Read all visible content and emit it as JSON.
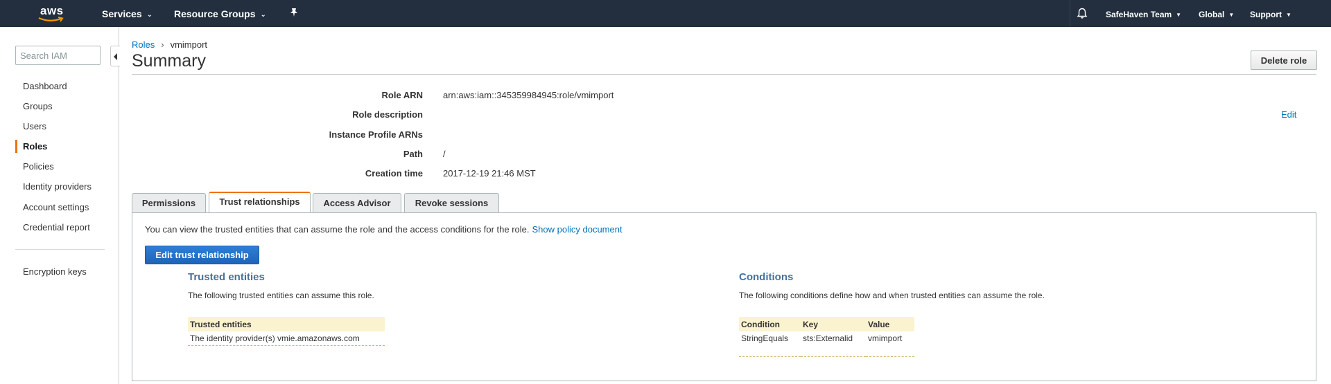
{
  "topnav": {
    "logo_text": "aws",
    "services": "Services",
    "resource_groups": "Resource Groups",
    "account": "SafeHaven Team",
    "region": "Global",
    "support": "Support"
  },
  "sidebar": {
    "search_placeholder": "Search IAM",
    "items": [
      {
        "label": "Dashboard"
      },
      {
        "label": "Groups"
      },
      {
        "label": "Users"
      },
      {
        "label": "Roles",
        "active": true
      },
      {
        "label": "Policies"
      },
      {
        "label": "Identity providers"
      },
      {
        "label": "Account settings"
      },
      {
        "label": "Credential report"
      }
    ],
    "secondary_items": [
      {
        "label": "Encryption keys"
      }
    ]
  },
  "breadcrumb": {
    "parent": "Roles",
    "separator": "›",
    "current": "vmimport"
  },
  "page": {
    "title": "Summary",
    "delete_button": "Delete role",
    "edit_link": "Edit"
  },
  "summary": {
    "role_arn_label": "Role ARN",
    "role_arn_value": "arn:aws:iam::345359984945:role/vmimport",
    "role_description_label": "Role description",
    "instance_profile_label": "Instance Profile ARNs",
    "path_label": "Path",
    "path_value": "/",
    "creation_time_label": "Creation time",
    "creation_time_value": "2017-12-19 21:46 MST"
  },
  "tabs": [
    {
      "label": "Permissions",
      "active": false
    },
    {
      "label": "Trust relationships",
      "active": true
    },
    {
      "label": "Access Advisor",
      "active": false
    },
    {
      "label": "Revoke sessions",
      "active": false
    }
  ],
  "trust": {
    "intro": "You can view the trusted entities that can assume the role and the access conditions for the role.",
    "show_policy_link": "Show policy document",
    "edit_button": "Edit trust relationship",
    "trusted_entities": {
      "title": "Trusted entities",
      "description": "The following trusted entities can assume this role.",
      "header": "Trusted entities",
      "rows": [
        "The identity provider(s) vmie.amazonaws.com"
      ]
    },
    "conditions": {
      "title": "Conditions",
      "description": "The following conditions define how and when trusted entities can assume the role.",
      "headers": [
        "Condition",
        "Key",
        "Value"
      ],
      "rows": [
        [
          "StringEquals",
          "sts:Externalid",
          "vmimport"
        ]
      ]
    }
  },
  "colors": {
    "nav_bg": "#232f3e",
    "link": "#0073bb",
    "accent_orange": "#ec7211",
    "primary_button": "#1f64b8",
    "section_title": "#44729f",
    "table_header_bg": "#fbf3cf"
  }
}
